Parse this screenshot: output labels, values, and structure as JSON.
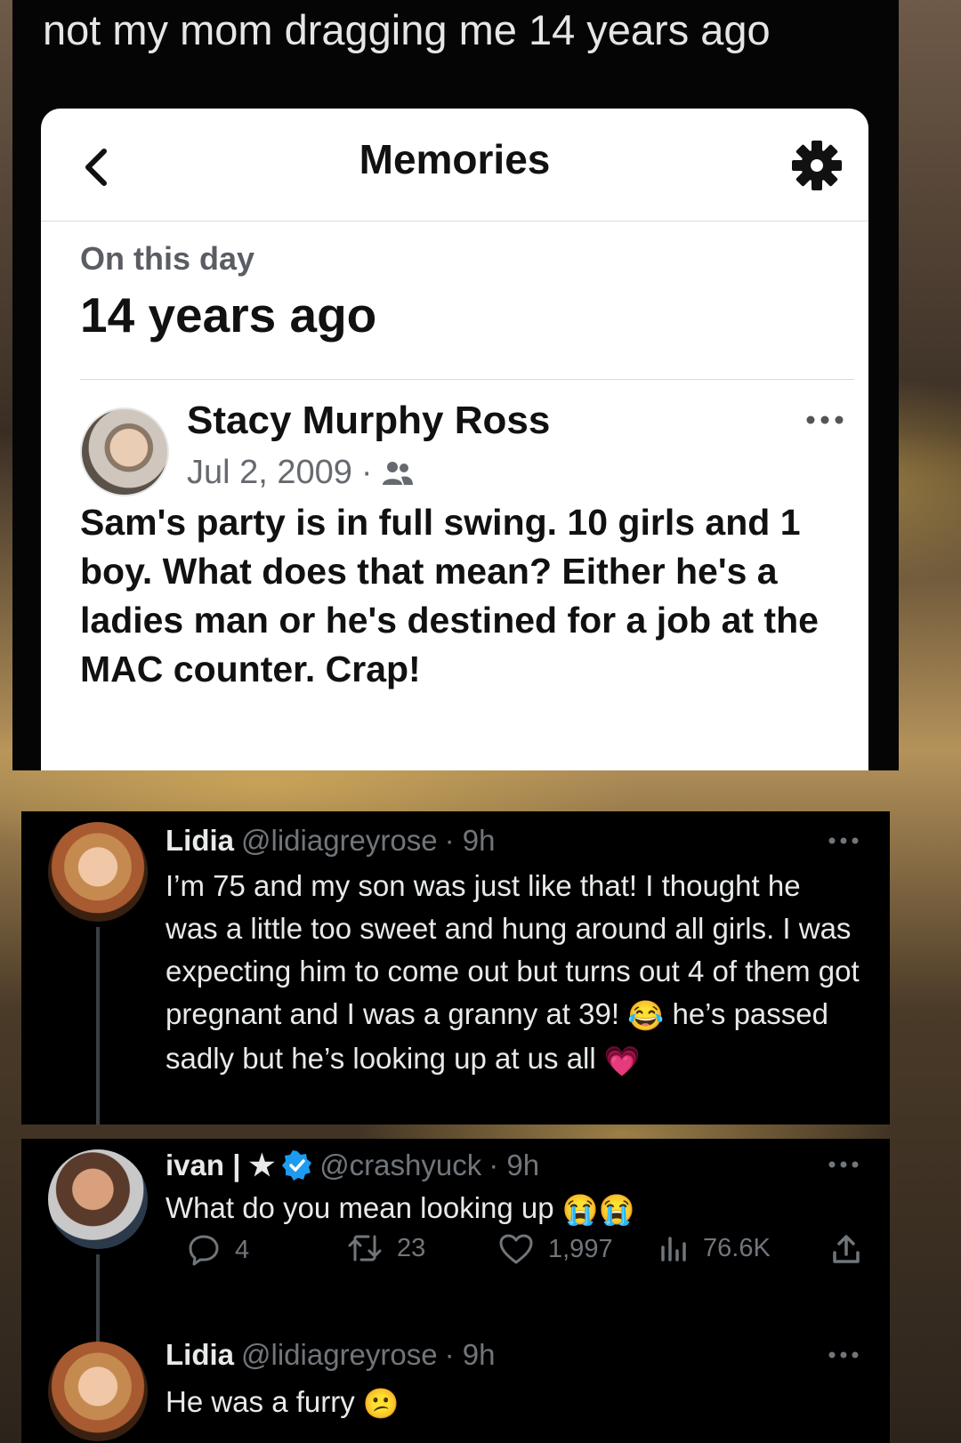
{
  "caption": "not my mom dragging me 14 years ago",
  "memories": {
    "title": "Memories",
    "back_icon": "chevron-left-icon",
    "settings_icon": "gear-icon",
    "section_label": "On this day",
    "years_ago": "14 years ago",
    "post": {
      "author": "Stacy Murphy Ross",
      "date": "Jul 2, 2009",
      "separator": "·",
      "audience_icon": "friends-icon",
      "text": "Sam's party is in full swing.  10 girls and 1 boy.  What does that mean?  Either he's a ladies man or he's destined for a job at the MAC counter. Crap!"
    }
  },
  "tweets": [
    {
      "name": "Lidia",
      "handle": "@lidiagreyrose",
      "time": "· 9h",
      "text_part1": "I’m 75 and my son was just like that! I thought he was a little too sweet and hung around all girls. I was expecting him to come out but turns out 4 of them got pregnant and I was a granny at 39!",
      "emoji1": "😂",
      "text_part2": "he’s passed sadly but he’s looking up at us all",
      "emoji2": "💗"
    },
    {
      "name": "ivan | ★",
      "handle": "@crashyuck",
      "time": "· 9h",
      "verified_icon": "verified-badge-icon",
      "text": "What do you mean looking up",
      "emoji": "😭😭",
      "stats": {
        "replies": "4",
        "retweets": "23",
        "likes": "1,997",
        "views": "76.6K"
      }
    },
    {
      "name": "Lidia",
      "handle": "@lidiagreyrose",
      "time": "· 9h",
      "text": "He was a furry",
      "emoji": "😕"
    }
  ],
  "colors": {
    "twitter_bg": "#000000",
    "twitter_text": "#e7e9ea",
    "twitter_muted": "#71767b",
    "verified_blue": "#1d9bf0"
  }
}
